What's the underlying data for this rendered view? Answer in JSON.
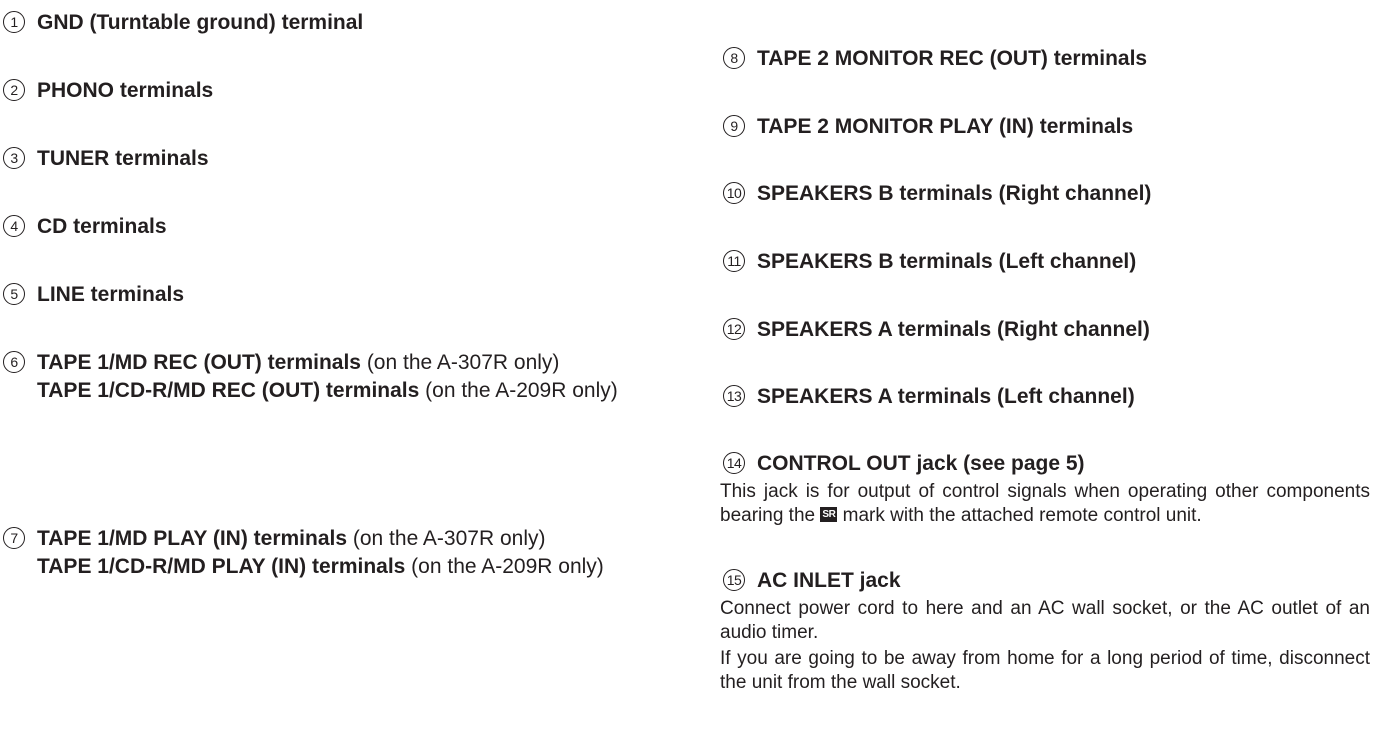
{
  "items": [
    {
      "num": "1",
      "title": "GND (Turntable ground) terminal"
    },
    {
      "num": "2",
      "title": "PHONO terminals"
    },
    {
      "num": "3",
      "title": "TUNER terminals"
    },
    {
      "num": "4",
      "title": "CD terminals"
    },
    {
      "num": "5",
      "title": "LINE terminals"
    },
    {
      "num": "6",
      "title": "TAPE 1/MD REC (OUT) terminals",
      "note": " (on the A-307R only)",
      "title2": "TAPE 1/CD-R/MD REC (OUT) terminals",
      "note2": " (on the A-209R only)"
    },
    {
      "num": "7",
      "title": "TAPE 1/MD PLAY (IN) terminals",
      "note": " (on the A-307R only)",
      "title2": "TAPE 1/CD-R/MD PLAY (IN) terminals",
      "note2": " (on the A-209R only)"
    },
    {
      "num": "8",
      "title": "TAPE 2 MONITOR REC (OUT) terminals"
    },
    {
      "num": "9",
      "title": "TAPE 2 MONITOR PLAY (IN) terminals"
    },
    {
      "num": "10",
      "title": "SPEAKERS B terminals (Right channel)"
    },
    {
      "num": "11",
      "title": "SPEAKERS B terminals (Left channel)"
    },
    {
      "num": "12",
      "title": "SPEAKERS A terminals (Right channel)"
    },
    {
      "num": "13",
      "title": "SPEAKERS A terminals (Left channel)"
    },
    {
      "num": "14",
      "title": "CONTROL OUT jack (see page 5)",
      "desc_a": "This jack is for output of control signals when operating other components bearing the ",
      "mark": "SR",
      "desc_b": " mark with the attached remote control unit."
    },
    {
      "num": "15",
      "title": "AC INLET jack",
      "desc1": "Connect power cord to here and an AC wall socket, or the AC outlet of an audio timer.",
      "desc2": "If you are going to be away from home for a long period of time, disconnect the unit from the wall socket."
    }
  ]
}
